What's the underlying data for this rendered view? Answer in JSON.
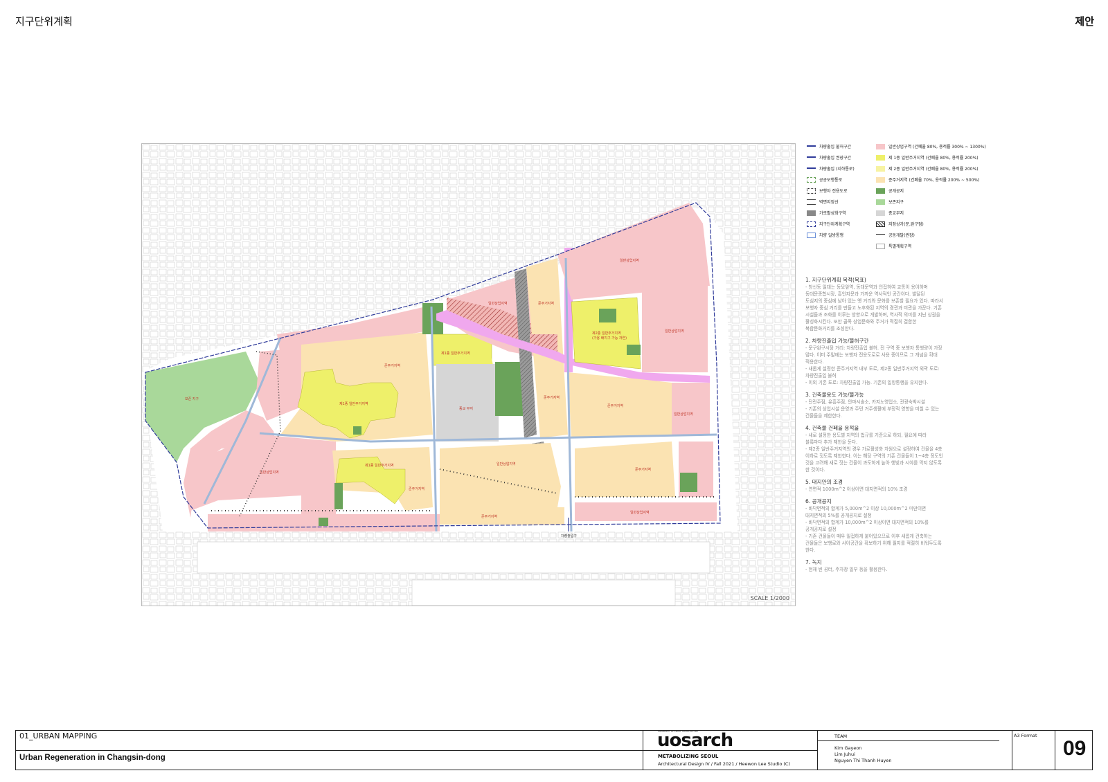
{
  "header": {
    "left": "지구단위계획",
    "right": "제안"
  },
  "map": {
    "scale": "SCALE 1/2000",
    "zone_labels": {
      "preservation": "보존 지구",
      "commercial_ne": "일반상업지역",
      "commercial_n": "일반상업지역",
      "quasi_n": "준주거지역",
      "res2_ne": "제2종 일반주거지역",
      "res2_ne_sub": "(가용 배지구 가능 자연)",
      "commercial_e": "일반상업지역",
      "res1_center": "제1종 일반주거지역",
      "quasi_center": "준주거지역",
      "res1_west": "제1종 일반주거지역",
      "religion": "종교 부지",
      "quasi_mid": "준주거지역",
      "quasi_east": "준주거지역",
      "commercial_e2": "일반상업지역",
      "commercial_sw": "일반상업지역",
      "res1_south": "제1종 일반주거지역",
      "quasi_south": "준주거지역",
      "commercial_mid": "일반상업지역",
      "quasi_se": "준주거지역",
      "quasi_bottom": "준주거지역",
      "commercial_bottom": "일반상업지역",
      "entrance": "차량출입구"
    },
    "colors": {
      "commercial": "#f7c6c9",
      "res1": "#eef06a",
      "res2": "#f7f3a2",
      "quasi": "#fbe3b2",
      "park": "#6aa35a",
      "preservation": "#a9d89a",
      "religion": "#d6d6d6",
      "pedestrian": "#f0a8ee",
      "road": "#2f3b9a"
    }
  },
  "legend": {
    "left": [
      {
        "label": "차량출입 불허구간",
        "icon": "road-no-entry-icon"
      },
      {
        "label": "차량출입 권장구간",
        "icon": "road-recommended-icon"
      },
      {
        "label": "차량출입 (지하통로)",
        "icon": "road-underground-icon"
      },
      {
        "label": "공공보행통로",
        "icon": "public-walkway-icon"
      },
      {
        "label": "보행자 전용도로",
        "icon": "pedestrian-road-icon"
      },
      {
        "label": "벽면지정선",
        "icon": "wall-line-icon"
      },
      {
        "label": "가로활성화구역",
        "icon": "street-activation-icon"
      },
      {
        "label": "지구단위계획구역",
        "icon": "district-boundary-icon"
      },
      {
        "label": "차량 일방통행",
        "icon": "one-way-icon"
      }
    ],
    "right": [
      {
        "label": "일반상업구역 (건폐율 80%, 용적률 300% ~ 1300%)",
        "color": "#f7c6c9"
      },
      {
        "label": "제 1종 일반주거지역 (건폐율 80%, 용적률 200%)",
        "color": "#eef06a"
      },
      {
        "label": "제 2종 일반주거지역 (건폐율 80%, 용적률 200%)",
        "color": "#f7f3a2"
      },
      {
        "label": "준주거지역 (건폐율 70%, 용적률 200% ~ 500%)",
        "color": "#fbe3b2"
      },
      {
        "label": "공개공지",
        "color": "#6aa35a"
      },
      {
        "label": "보존지구",
        "color": "#a9d89a"
      },
      {
        "label": "종교부지",
        "color": "#d6d6d6"
      },
      {
        "label": "지정상가(문,완구점)",
        "color": "hatch"
      },
      {
        "label": "공동개발(권장)",
        "color": "arrow"
      },
      {
        "label": "특별계획구역",
        "color": "#ffffff"
      }
    ]
  },
  "notes": [
    {
      "heading": "1. 지구단위계획 목적(목표)",
      "lines": [
        "- 창신동 일대는 동묘앞역, 동대문역과 인접하여 교통이 용이하며",
        "동대문종합시장, 흥인지문과 가까운 역사적인 공간이다. 발달된",
        "도심지의 중심에 남아 있는 옛 거리와 문화를 보존할 필요가 있다. 따라서",
        "보행자 중심 거리를 만들고 노후화된 지역의 경관과 미관을 가꾼다. 기존",
        "시설들과 조화를 이루는 방향으로 개발하며, 역사적 의미를 지닌 상권을",
        "활성화시킨다. 또한 골목 상업문화와 주거가 적절히 결합한",
        "복합문화거리를 조성한다."
      ]
    },
    {
      "heading": "2. 차량진출입 가능/불허구간",
      "lines": [
        "- 문구완구시장 거리: 차량진출입 불허. 전 구역 중 보행자 통행량이 가장",
        "많다. 이미 주말에는 보행자 전용도로로 사용 중이므로 그 개념을 확대",
        "적용한다.",
        "- 새롭게 설정한 준주거지역 내부 도로, 제2종 일반주거지역 외곽 도로:",
        "차량진출입 불허",
        "- 이외 기존 도로: 차량진출입 가능. 기존의 일방통행을 유지한다."
      ]
    },
    {
      "heading": "3. 건축물용도 가능/불가능",
      "lines": [
        "- 단란주점, 유흥주점, 안마시술소, 카지노영업소, 관광숙박시설",
        "- 기존의 상업시설 운영과 주민 거주생활에 부정적 영향을 미칠 수 있는",
        "건물들을 제한한다."
      ]
    },
    {
      "heading": "4. 건축물 건폐율 용적율",
      "lines": [
        "- 새로 설정한 용도별 지역의 법규를 기준으로 하되, 필요에 따라",
        "블록마다 추가 제한을 둔다.",
        "- 제2종 일반주거지역의 경우 가로활성화 차원으로 설정하여 건물을 4층",
        "이하로 짓도록 제한한다. 이는 해당 구역의 기존 건물들이 1~4층 정도인",
        "것을 고려해 새로 짓는 건물이 과도하게 높아 햇빛과 시야를 막지 않도록",
        "한 것이다."
      ]
    },
    {
      "heading": "5. 대지안의 조경",
      "lines": [
        "- 연면적 1000m^2 이상이면 대지면적의 10% 조경"
      ]
    },
    {
      "heading": "6. 공개공지",
      "lines": [
        "- 바닥면적의 합계가 5,000m^2 이상 10,000m^2 미만이면",
        "대지면적의 5%를 공개공지로 설정",
        "- 바닥면적의 합계가 10,000m^2 이상이면 대지면적의 10%를",
        "공개공지로 설정",
        "- 기존 건물들이 매우 밀접하게 붙어있으므로 이후 새롭게 건축하는",
        "건물들은 보행로와 사이공간을 확보하기 위해 필지를 적절히 비워두도록",
        "한다."
      ]
    },
    {
      "heading": "7. 녹지",
      "lines": [
        "- 현재 빈 공터, 주차장 일부 등을 활용한다."
      ]
    }
  ],
  "footer": {
    "section": "01_URBAN MAPPING",
    "title": "Urban Regeneration in Changsin-dong",
    "logo_small": "UNIVERSITY OF SEOUL ARCHITECTURE",
    "logo": "uosarch",
    "project": "METABOLIZING SEOUL",
    "course": "Architectural Design IV / Fall 2021 / Heewon Lee Studio (C)",
    "team_label": "TEAM",
    "members": [
      "Kim Gayeon",
      "Lim Juhui",
      "Nguyen Thi Thanh Huyen"
    ],
    "format": "A3 Format",
    "page": "09"
  }
}
